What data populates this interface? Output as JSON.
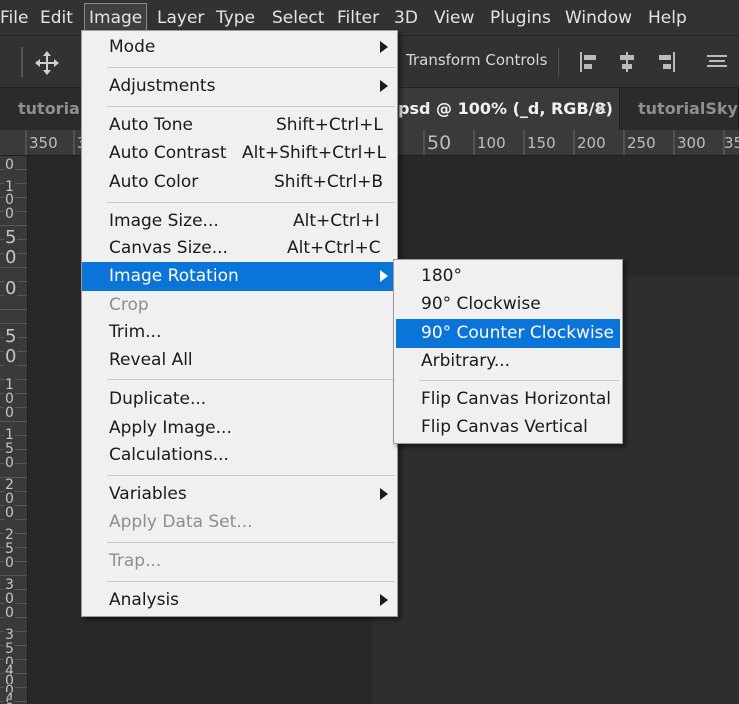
{
  "menubar": {
    "items": [
      "File",
      "Edit",
      "Image",
      "Layer",
      "Type",
      "Select",
      "Filter",
      "3D",
      "View",
      "Plugins",
      "Window",
      "Help"
    ],
    "active": "Image"
  },
  "options_bar": {
    "transform_controls_label": "Transform Controls",
    "show_transform_controls_checked": false
  },
  "tabs": [
    {
      "label": "tutorialS",
      "active": false
    },
    {
      "label": "psd @ 100% (_d, RGB/8)",
      "active": true,
      "close": "×"
    },
    {
      "label": "tutorialSky_r.",
      "active": false
    }
  ],
  "ruler_top": {
    "labels": [
      "350",
      "3",
      "50",
      "100",
      "150",
      "200",
      "250",
      "300",
      "35"
    ]
  },
  "ruler_left": {
    "digits": [
      "0",
      "1",
      "0",
      "0",
      "5",
      "0",
      "0",
      "5",
      "0",
      "1",
      "0",
      "0",
      "1",
      "5",
      "0",
      "2",
      "0",
      "0",
      "2",
      "5",
      "0",
      "3",
      "0",
      "0",
      "3",
      "5",
      "0",
      "4",
      "0",
      "0",
      "4",
      "5",
      "0"
    ]
  },
  "image_menu": {
    "mode": "Mode",
    "adjustments": "Adjustments",
    "auto_tone": "Auto Tone",
    "auto_tone_shortcut": "Shift+Ctrl+L",
    "auto_contrast": "Auto Contrast",
    "auto_contrast_shortcut": "Alt+Shift+Ctrl+L",
    "auto_color": "Auto Color",
    "auto_color_shortcut": "Shift+Ctrl+B",
    "image_size": "Image Size...",
    "image_size_shortcut": "Alt+Ctrl+I",
    "canvas_size": "Canvas Size...",
    "canvas_size_shortcut": "Alt+Ctrl+C",
    "image_rotation": "Image Rotation",
    "crop": "Crop",
    "trim": "Trim...",
    "reveal_all": "Reveal All",
    "duplicate": "Duplicate...",
    "apply_image": "Apply Image...",
    "calculations": "Calculations...",
    "variables": "Variables",
    "apply_data_set": "Apply Data Set...",
    "trap": "Trap...",
    "analysis": "Analysis"
  },
  "rotation_submenu": {
    "rot_180": "180°",
    "rot_90_cw": "90° Clockwise",
    "rot_90_ccw": "90° Counter Clockwise",
    "arbitrary": "Arbitrary...",
    "flip_h": "Flip Canvas Horizontal",
    "flip_v": "Flip Canvas Vertical"
  },
  "colors": {
    "highlight": "#0a74d8",
    "menu_bg": "#f0f0f0",
    "app_bg": "#282828"
  }
}
